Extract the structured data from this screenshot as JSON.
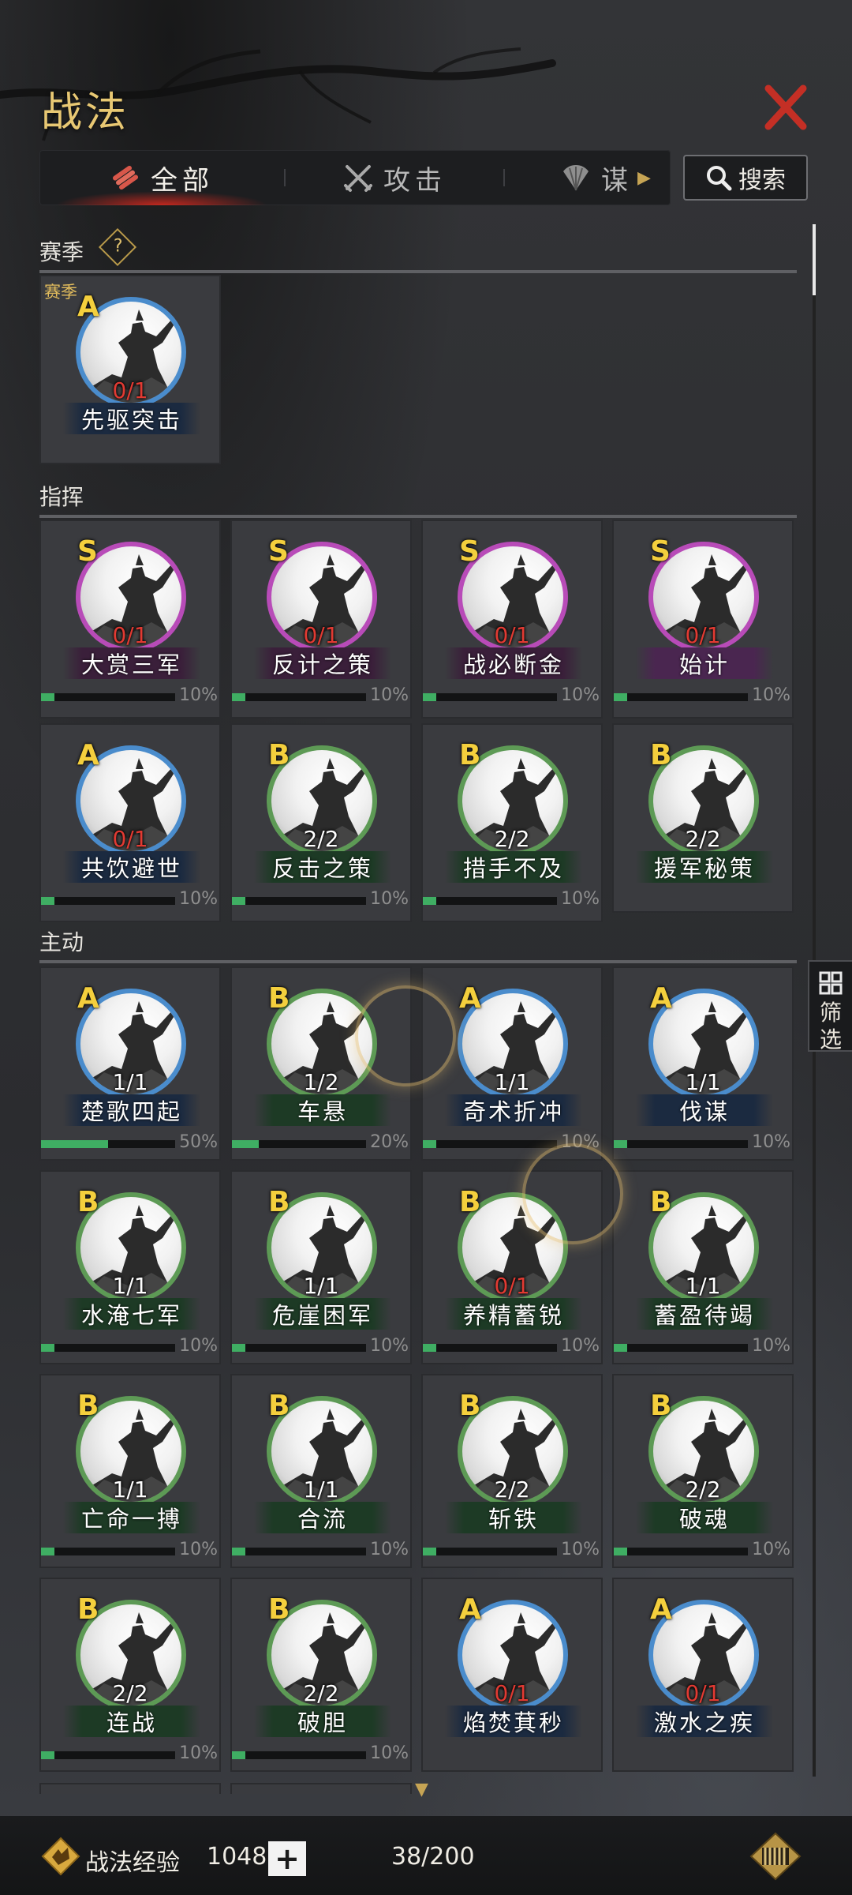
{
  "title": "战法",
  "tabs": [
    {
      "label": "全部",
      "icon": "scroll-bundle-icon",
      "active": true
    },
    {
      "label": "攻击",
      "icon": "crossed-swords-icon",
      "active": false
    },
    {
      "label": "谋",
      "icon": "fan-icon",
      "active": false
    }
  ],
  "search_label": "搜索",
  "filter_label": "筛选",
  "sections": {
    "season": {
      "title": "赛季",
      "help": "?",
      "cards": [
        {
          "tag": "赛季",
          "grade": "A",
          "count": "0/1",
          "name": "先驱突击"
        }
      ]
    },
    "command": {
      "title": "指挥",
      "cards": [
        {
          "grade": "S",
          "count": "0/1",
          "name": "大赏三军",
          "progress": 10,
          "pct": "10%"
        },
        {
          "grade": "S",
          "count": "0/1",
          "name": "反计之策",
          "progress": 10,
          "pct": "10%"
        },
        {
          "grade": "S",
          "count": "0/1",
          "name": "战必断金",
          "progress": 10,
          "pct": "10%"
        },
        {
          "grade": "S",
          "count": "0/1",
          "name": "始计",
          "progress": 10,
          "pct": "10%"
        },
        {
          "grade": "A",
          "count": "0/1",
          "name": "共饮避世",
          "progress": 10,
          "pct": "10%"
        },
        {
          "grade": "B",
          "count": "2/2",
          "name": "反击之策",
          "progress": 10,
          "pct": "10%"
        },
        {
          "grade": "B",
          "count": "2/2",
          "name": "措手不及",
          "progress": 10,
          "pct": "10%"
        },
        {
          "grade": "B",
          "count": "2/2",
          "name": "援军秘策"
        }
      ]
    },
    "active": {
      "title": "主动",
      "cards": [
        {
          "grade": "A",
          "count": "1/1",
          "name": "楚歌四起",
          "progress": 50,
          "pct": "50%"
        },
        {
          "grade": "B",
          "count": "1/2",
          "name": "车悬",
          "progress": 20,
          "pct": "20%"
        },
        {
          "grade": "A",
          "count": "1/1",
          "name": "奇术折冲",
          "progress": 10,
          "pct": "10%"
        },
        {
          "grade": "A",
          "count": "1/1",
          "name": "伐谋",
          "progress": 10,
          "pct": "10%"
        },
        {
          "grade": "B",
          "count": "1/1",
          "name": "水淹七军",
          "progress": 10,
          "pct": "10%"
        },
        {
          "grade": "B",
          "count": "1/1",
          "name": "危崖困军",
          "progress": 10,
          "pct": "10%"
        },
        {
          "grade": "B",
          "count": "0/1",
          "name": "养精蓄锐",
          "progress": 10,
          "pct": "10%"
        },
        {
          "grade": "B",
          "count": "1/1",
          "name": "蓄盈待竭",
          "progress": 10,
          "pct": "10%"
        },
        {
          "grade": "B",
          "count": "1/1",
          "name": "亡命一搏",
          "progress": 10,
          "pct": "10%"
        },
        {
          "grade": "B",
          "count": "1/1",
          "name": "合流",
          "progress": 10,
          "pct": "10%"
        },
        {
          "grade": "B",
          "count": "2/2",
          "name": "斩铁",
          "progress": 10,
          "pct": "10%"
        },
        {
          "grade": "B",
          "count": "2/2",
          "name": "破魂",
          "progress": 10,
          "pct": "10%"
        },
        {
          "grade": "B",
          "count": "2/2",
          "name": "连战",
          "progress": 10,
          "pct": "10%"
        },
        {
          "grade": "B",
          "count": "2/2",
          "name": "破胆",
          "progress": 10,
          "pct": "10%"
        },
        {
          "grade": "A",
          "count": "0/1",
          "name": "焰焚萁秒"
        },
        {
          "grade": "A",
          "count": "0/1",
          "name": "激水之疾"
        }
      ]
    }
  },
  "footer": {
    "exp_label": "战法经验",
    "exp_value": "10483",
    "add_label": "+",
    "capacity": "38/200"
  },
  "colors": {
    "grade_S": "#b84bb8",
    "grade_A": "#4a8ccc",
    "grade_B": "#5d9a55",
    "gold": "#e8c873",
    "zero_count": "#e23a32",
    "progress": "#3fae63"
  }
}
